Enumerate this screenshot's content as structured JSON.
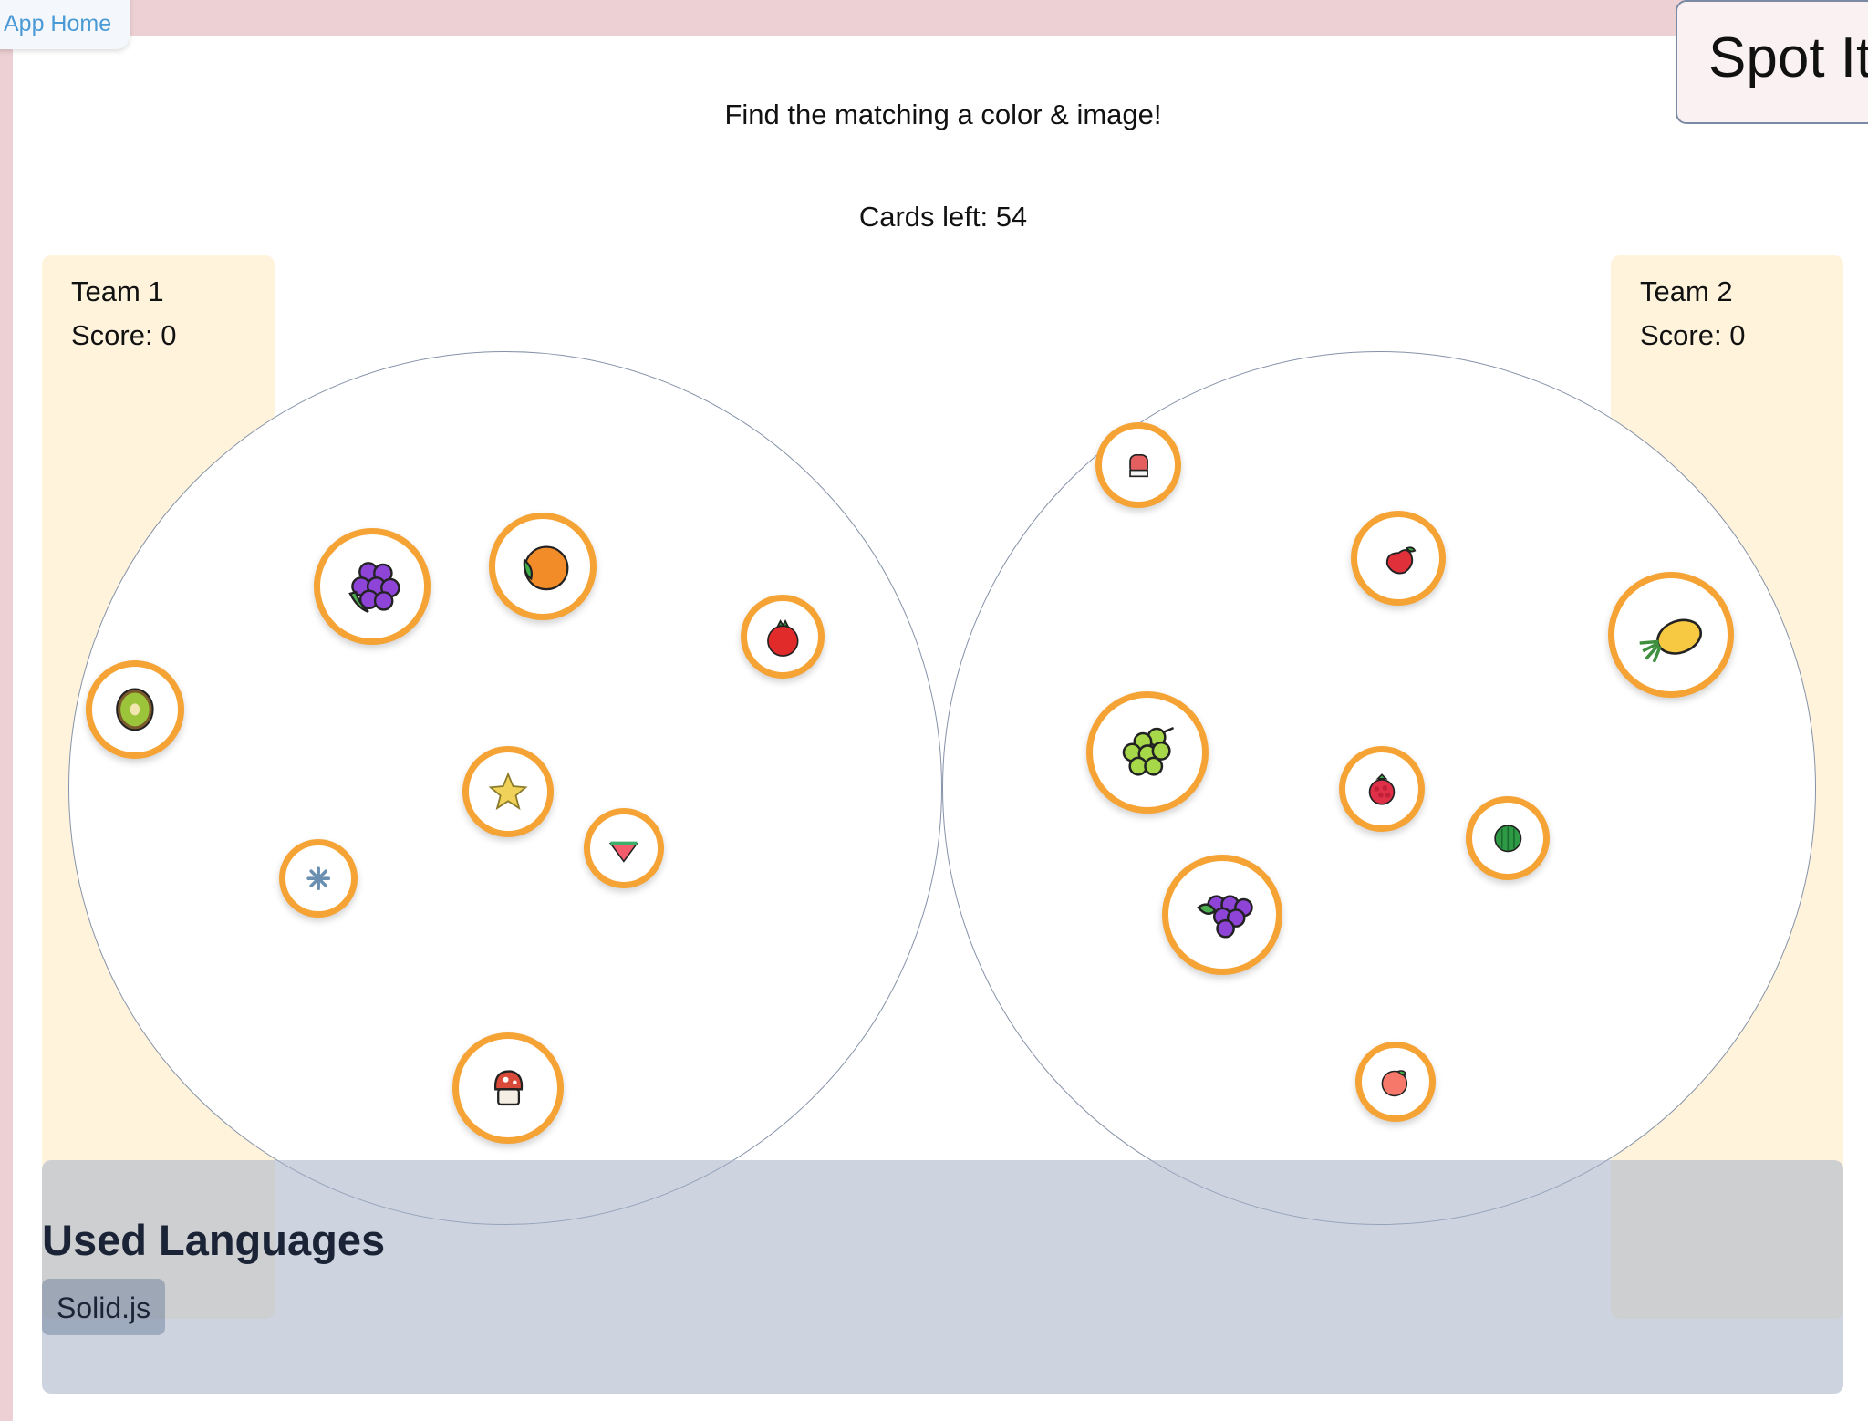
{
  "nav": {
    "home_link": "App Home"
  },
  "app_title": "Spot It",
  "instruction": "Find the matching a color & image!",
  "cards_left": "Cards left: 54",
  "teams": [
    {
      "name": "Team 1",
      "score": "Score: 0"
    },
    {
      "name": "Team 2",
      "score": "Score: 0"
    }
  ],
  "cards": [
    {
      "symbols": [
        "grapes-purple-icon",
        "orange-icon",
        "pomegranate-icon",
        "kiwi-icon",
        "star-fruit-icon",
        "snowflake-icon",
        "watermelon-slice-icon",
        "mushroom-icon"
      ]
    },
    {
      "symbols": [
        "mitten-icon",
        "pear-icon",
        "pineapple-icon",
        "grapes-green-icon",
        "raspberry-icon",
        "watermelon-icon",
        "grapes-purple-icon",
        "peach-icon"
      ]
    }
  ],
  "symbol_color": "#f5a334",
  "footer": {
    "heading": "Used Languages",
    "languages": [
      "Solid.js"
    ]
  }
}
